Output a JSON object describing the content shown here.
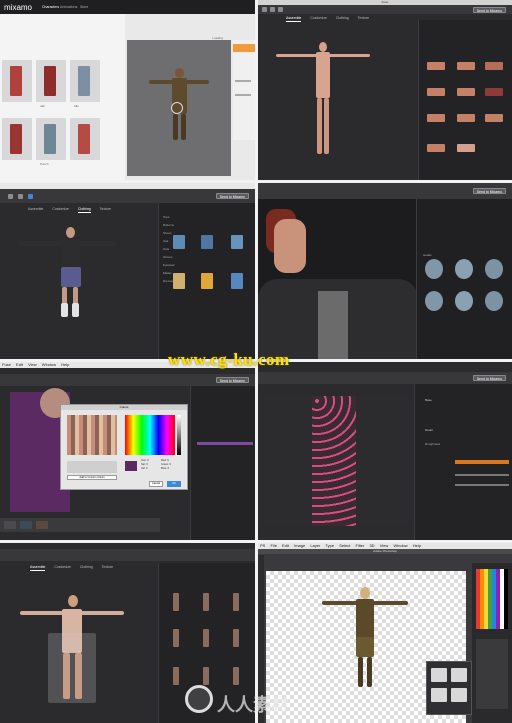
{
  "watermark": "www.cg-ku.com",
  "logo_text": "人人素材",
  "colors": {
    "accent_orange": "#f39a3c",
    "dark_ui": "#2b2b2e",
    "watermark_yellow": "#ffe200"
  },
  "panel1": {
    "brand": "mixamo",
    "tab_characters": "Characters",
    "tab_animations": "Animations",
    "tab_store": "Store",
    "thumb_labels": [
      "Jab",
      "Punch",
      "Idle"
    ],
    "preview_label": "Loading"
  },
  "panel2": {
    "title": "Fuse",
    "tabs": [
      "Assemble",
      "Customize",
      "Clothing",
      "Texture"
    ],
    "send_label": "Send to Mixamo"
  },
  "panel3": {
    "tabs": [
      "Assemble",
      "Customize",
      "Clothing",
      "Texture"
    ],
    "send_label": "Send to Mixamo",
    "categories": [
      "Tops",
      "Bottoms",
      "Shoes",
      "Hair",
      "Hats",
      "Gloves",
      "Eyewear",
      "Masks",
      "Dresses"
    ]
  },
  "panel4": {
    "send_label": "Send to Mixamo",
    "section": "Heads"
  },
  "panel5": {
    "menu": [
      "Fuse",
      "Edit",
      "View",
      "Window",
      "Help"
    ],
    "send_label": "Send to Mixamo",
    "dialog_title": "Colors",
    "button_add": "Add to Custom Colors",
    "button_cancel": "Cancel",
    "button_ok": "OK",
    "labels": [
      "Hue:",
      "Sat:",
      "Val:",
      "Red:",
      "Green:",
      "Blue:"
    ],
    "values": [
      "0",
      "0",
      "0",
      "0",
      "0",
      "0"
    ]
  },
  "panel6": {
    "send_label": "Send to Mixamo",
    "section": "Roughness",
    "options": [
      "Base",
      "Detail"
    ]
  },
  "panel7": {
    "tabs": [
      "Assemble",
      "Customize",
      "Clothing",
      "Texture"
    ]
  },
  "panel8": {
    "menu": [
      "PS",
      "File",
      "Edit",
      "Image",
      "Layer",
      "Type",
      "Select",
      "Filter",
      "3D",
      "View",
      "Window",
      "Help"
    ],
    "title": "Adobe Photoshop"
  }
}
